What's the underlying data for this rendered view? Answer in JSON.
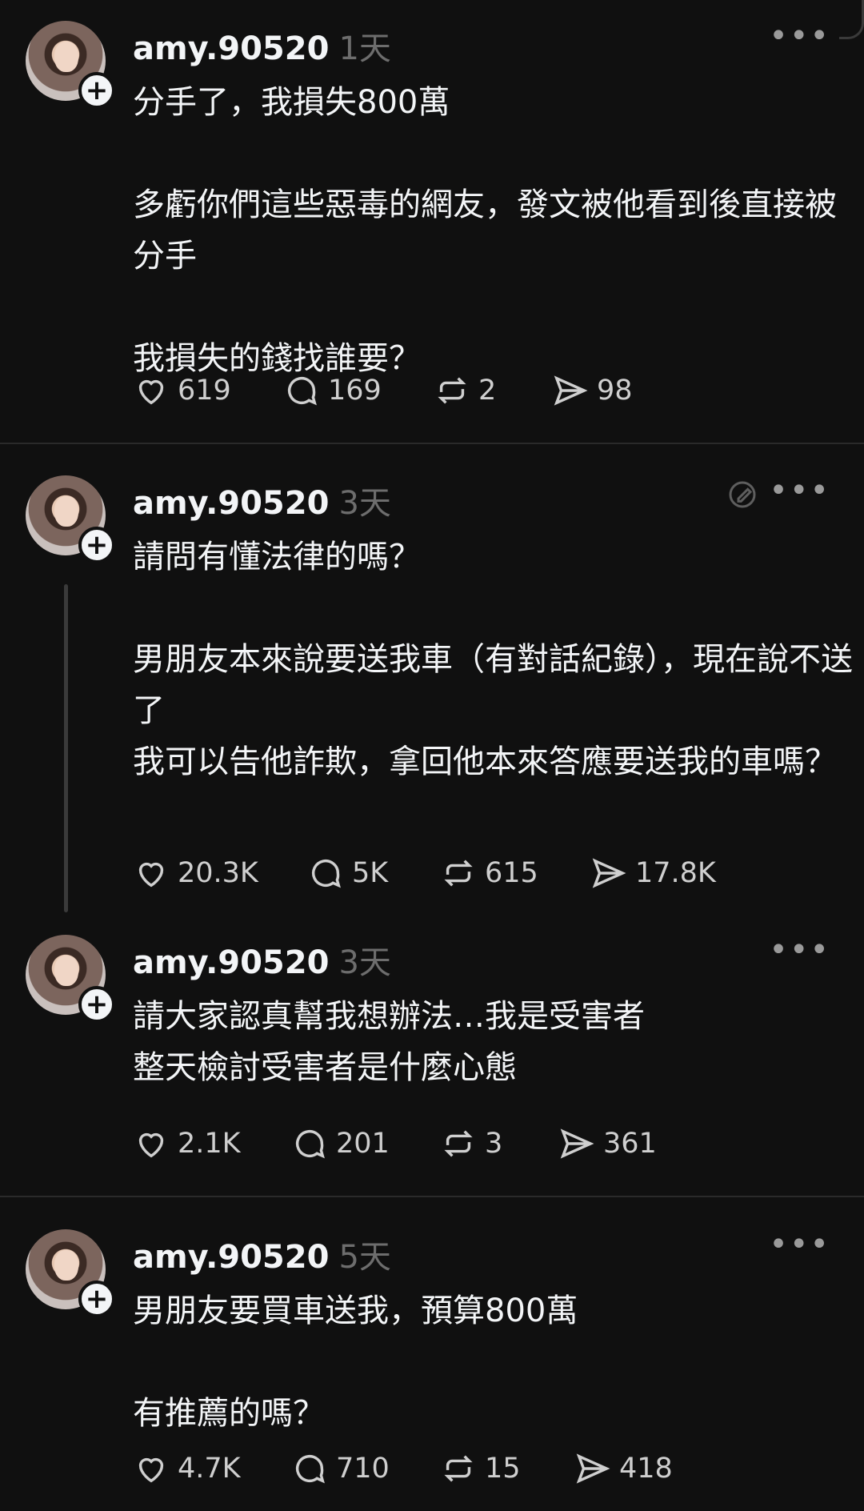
{
  "posts": [
    {
      "username": "amy.90520",
      "time": "1天",
      "text": "分手了，我損失800萬\n\n多虧你們這些惡毒的網友，發文被他看到後直接被分手\n\n我損失的錢找誰要？",
      "stats": {
        "likes": "619",
        "replies": "169",
        "reposts": "2",
        "shares": "98"
      }
    },
    {
      "username": "amy.90520",
      "time": "3天",
      "text": "請問有懂法律的嗎？\n\n男朋友本來說要送我車（有對話紀錄），現在說不送了\n我可以告他詐欺，拿回他本來答應要送我的車嗎？",
      "stats": {
        "likes": "20.3K",
        "replies": "5K",
        "reposts": "615",
        "shares": "17.8K"
      }
    },
    {
      "username": "amy.90520",
      "time": "3天",
      "text": "請大家認真幫我想辦法…我是受害者\n整天檢討受害者是什麼心態",
      "stats": {
        "likes": "2.1K",
        "replies": "201",
        "reposts": "3",
        "shares": "361"
      }
    },
    {
      "username": "amy.90520",
      "time": "5天",
      "text": "男朋友要買車送我，預算800萬\n\n有推薦的嗎？",
      "stats": {
        "likes": "4.7K",
        "replies": "710",
        "reposts": "15",
        "shares": "418"
      }
    }
  ],
  "icons": {
    "like": "heart-icon",
    "reply": "comment-icon",
    "repost": "repost-icon",
    "share": "send-icon",
    "more": "more-icon",
    "edit": "edited-icon",
    "follow": "plus-icon"
  },
  "colors": {
    "background": "#101010",
    "text": "#f3f5f7",
    "muted": "#6d6d6d"
  }
}
